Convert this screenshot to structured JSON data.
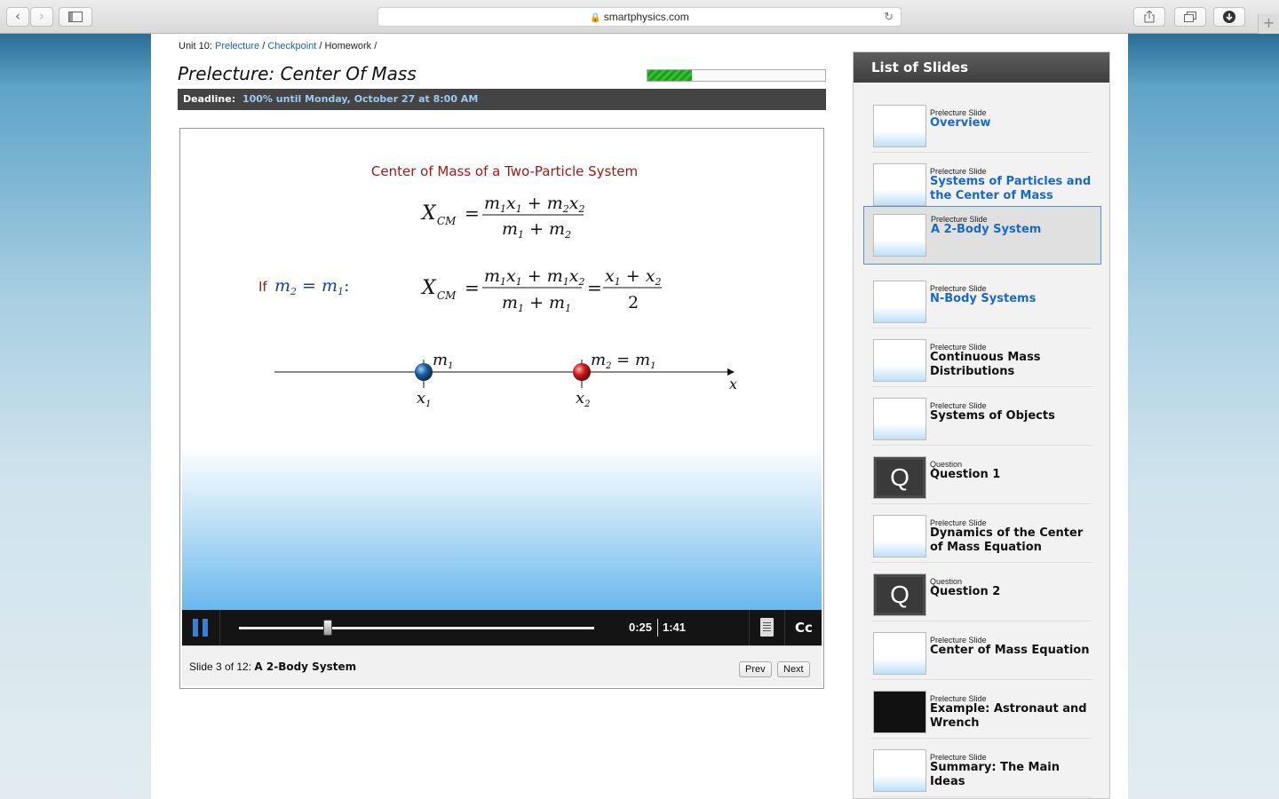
{
  "browser": {
    "url": "smartphysics.com",
    "back_icon": "chevron-left-icon",
    "forward_icon": "chevron-right-icon"
  },
  "breadcrumb": {
    "unit": "Unit 10:",
    "prelecture": "Prelecture",
    "checkpoint": "Checkpoint",
    "homework": "Homework",
    "separator": "/"
  },
  "header": {
    "title": "Prelecture: Center Of Mass",
    "progress_fraction": 0.25,
    "deadline_label": "Deadline:",
    "deadline_value": "100% until Monday, October 27 at 8:00 AM"
  },
  "slide": {
    "heading": "Center of Mass of a Two-Particle System",
    "if_label": "If",
    "axis_label": "x",
    "colors": {
      "heading": "#a01818",
      "eq_blue": "#1b3f9e",
      "particle1": "#1e5e9a",
      "particle2": "#d21a1a"
    }
  },
  "player": {
    "current_time": "0:25",
    "total_time": "1:41",
    "progress_fraction": 0.25,
    "cc_label": "Cc",
    "slide_count_text": "Slide 3 of 12:",
    "slide_name": "A 2-Body System",
    "prev_label": "Prev",
    "next_label": "Next"
  },
  "sidebar": {
    "title": "List of Slides",
    "items": [
      {
        "type": "Prelecture Slide",
        "title": "Overview",
        "link": true
      },
      {
        "type": "Prelecture Slide",
        "title": "Systems of Particles and the Center of Mass",
        "link": true
      },
      {
        "type": "Prelecture Slide",
        "title": "A 2-Body System",
        "link": true,
        "active": true
      },
      {
        "type": "Prelecture Slide",
        "title": "N-Body Systems",
        "link": true
      },
      {
        "type": "Prelecture Slide",
        "title": "Continuous Mass Distributions",
        "link": false
      },
      {
        "type": "Prelecture Slide",
        "title": "Systems of Objects",
        "link": false
      },
      {
        "type": "Question",
        "title": "Question 1",
        "link": false,
        "thumb": "Q"
      },
      {
        "type": "Prelecture Slide",
        "title": "Dynamics of the Center of Mass Equation",
        "link": false
      },
      {
        "type": "Question",
        "title": "Question 2",
        "link": false,
        "thumb": "Q"
      },
      {
        "type": "Prelecture Slide",
        "title": "Center of Mass Equation",
        "link": false
      },
      {
        "type": "Prelecture Slide",
        "title": "Example: Astronaut and Wrench",
        "link": false
      },
      {
        "type": "Prelecture Slide",
        "title": "Summary: The Main Ideas",
        "link": false
      }
    ]
  }
}
